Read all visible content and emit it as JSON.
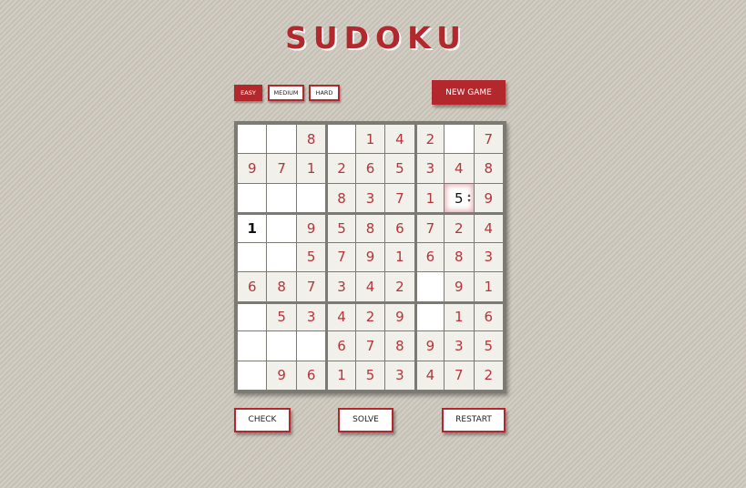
{
  "title": "SUDOKU",
  "difficulty": {
    "options": [
      {
        "label": "EASY",
        "active": true
      },
      {
        "label": "MEDIUM",
        "active": false
      },
      {
        "label": "HARD",
        "active": false
      }
    ]
  },
  "new_game_label": "NEW GAME",
  "board": {
    "rows": [
      [
        "",
        "",
        "8",
        "",
        "1",
        "4",
        "2",
        "",
        "7"
      ],
      [
        "9",
        "7",
        "1",
        "2",
        "6",
        "5",
        "3",
        "4",
        "8"
      ],
      [
        "",
        "",
        "",
        "8",
        "3",
        "7",
        "1",
        "5",
        "9"
      ],
      [
        "1",
        "",
        "9",
        "5",
        "8",
        "6",
        "7",
        "2",
        "4"
      ],
      [
        "",
        "",
        "5",
        "7",
        "9",
        "1",
        "6",
        "8",
        "3"
      ],
      [
        "6",
        "8",
        "7",
        "3",
        "4",
        "2",
        "",
        "9",
        "1"
      ],
      [
        "",
        "5",
        "3",
        "4",
        "2",
        "9",
        "",
        "1",
        "6"
      ],
      [
        "",
        "",
        "",
        "6",
        "7",
        "8",
        "9",
        "3",
        "5"
      ],
      [
        "",
        "9",
        "6",
        "1",
        "5",
        "3",
        "4",
        "7",
        "2"
      ]
    ],
    "user_entries": [
      [
        3,
        0
      ],
      [
        2,
        7
      ]
    ],
    "focused_cell": [
      2,
      7
    ]
  },
  "actions": {
    "check_label": "CHECK",
    "solve_label": "SOLVE",
    "restart_label": "RESTART"
  },
  "colors": {
    "accent": "#b3282d",
    "given_digit": "#b3363b",
    "user_digit": "#111111"
  }
}
